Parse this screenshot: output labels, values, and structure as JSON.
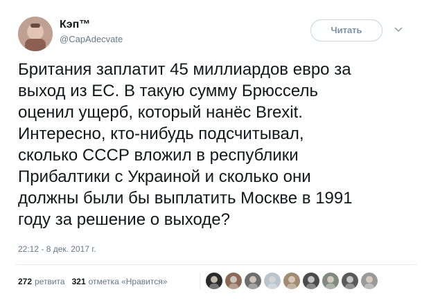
{
  "author": {
    "display_name": "Кэп™",
    "handle": "@CapAdecvate",
    "avatar_icon": "profile-photo"
  },
  "follow_button": {
    "label": "Читать"
  },
  "menu": {
    "icon": "chevron-down-icon"
  },
  "tweet": {
    "text": "Британия заплатит 45 миллиардов евро за\nвыход из ЕС. В такую сумму Брюссель\nоценил ущерб, который нанёс Brexit.\nИнтересно, кто-нибудь подсчитывал,\nсколько СССР вложил в республики\nПрибалтики с Украиной и сколько они\nдолжны были бы выплатить Москве в 1991\nгоду за решение о выходе?",
    "timestamp": "22:12 - 8 дек. 2017 г."
  },
  "stats": {
    "retweets_count": "272",
    "retweets_label": "ретвита",
    "likes_count": "321",
    "likes_label": "отметка «Нравится»"
  },
  "likers": [
    {
      "icon": "liker-avatar-1",
      "color": "#2a2a2a"
    },
    {
      "icon": "liker-avatar-2",
      "color": "#8c6a55"
    },
    {
      "icon": "liker-avatar-3",
      "color": "#6d6d6d"
    },
    {
      "icon": "liker-avatar-4",
      "color": "#b9c4cc"
    },
    {
      "icon": "liker-avatar-5",
      "color": "#a08a70"
    },
    {
      "icon": "liker-avatar-6",
      "color": "#4b4b4b"
    },
    {
      "icon": "liker-avatar-7",
      "color": "#7f8a80"
    },
    {
      "icon": "liker-avatar-8",
      "color": "#5a5a5a"
    },
    {
      "icon": "liker-avatar-9",
      "color": "#9a9a9a"
    }
  ],
  "colors": {
    "text": "#14171a",
    "secondary": "#657786",
    "follow_border": "#c5d3dd",
    "follow_text": "#7a93a8",
    "divider": "#e6ecf0"
  }
}
